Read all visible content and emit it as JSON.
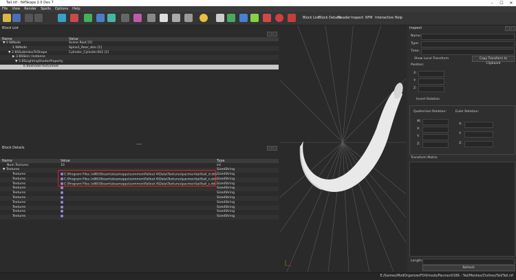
{
  "window": {
    "title": "Tail.nif - NifSkope 2.0 Dev 7"
  },
  "menu": [
    "File",
    "View",
    "Render",
    "Spells",
    "Options",
    "Help"
  ],
  "toolbar_buttons": [
    "Block List",
    "Block Details",
    "Header",
    "Inspect",
    "KFM",
    "Interactive Help"
  ],
  "block_list": {
    "title": "Block List",
    "columns": [
      "Name",
      "Value"
    ],
    "rows": [
      {
        "name": "▼ 0 NiNode",
        "value": "Scene Root [0]"
      },
      {
        "name": "1 NiNode",
        "value": "Spine1_Rear_skin [1]"
      },
      {
        "name": "▼ 2 BSSubIndexTriShape",
        "value": "Cylinder_Cylinder.002 [2]"
      },
      {
        "name": "▶ 3 BSSkin::Instance",
        "value": ""
      },
      {
        "name": "▼ 5 BSLightingShaderProperty",
        "value": ""
      },
      {
        "name": "6 BSShaderTextureSet",
        "value": ""
      }
    ]
  },
  "block_details": {
    "title": "Block Details",
    "columns": [
      "Name",
      "Value",
      "Type"
    ],
    "rows": [
      {
        "name": "Num Textures",
        "value": "10",
        "type": "int"
      },
      {
        "name": "▼ Textures",
        "value": "",
        "type": "SizedString"
      },
      {
        "name": "Textures",
        "value": "C:\\Program Files (x86)\\Steam\\steamapps\\common\\Fallout 4\\Data\\Textures\\pacmen\\tail\\tail_d.dds",
        "type": "SizedString"
      },
      {
        "name": "Textures",
        "value": "C:\\Program Files (x86)\\Steam\\steamapps\\common\\Fallout 4\\Data\\Textures\\pacmen\\tail\\tail_n.dds",
        "type": "SizedString"
      },
      {
        "name": "Textures",
        "value": "C:\\Program Files (x86)\\Steam\\steamapps\\common\\Fallout 4\\Data\\Textures\\pacmen\\tail\\tail_s.dds",
        "type": "SizedString"
      },
      {
        "name": "Textures",
        "value": "",
        "type": "SizedString"
      },
      {
        "name": "Textures",
        "value": "",
        "type": "SizedString"
      },
      {
        "name": "Textures",
        "value": "",
        "type": "SizedString"
      },
      {
        "name": "Textures",
        "value": "",
        "type": "SizedString"
      },
      {
        "name": "Textures",
        "value": "",
        "type": "SizedString"
      },
      {
        "name": "Textures",
        "value": "",
        "type": "SizedString"
      },
      {
        "name": "Textures",
        "value": "",
        "type": "SizedString"
      }
    ]
  },
  "inspect": {
    "title": "Inspect",
    "fields": [
      "Name:",
      "Type:",
      "Time:"
    ],
    "show_local": "Show Local Transform",
    "copy_btn": "Copy Transform to Clipboard",
    "position": "Position:",
    "pos_axes": [
      "X:",
      "Y:",
      "Z:"
    ],
    "invert_rotation": "Invert Rotation",
    "quaternion": "Quaternion Rotation:",
    "quat_axes": [
      "W:",
      "X:",
      "Y:",
      "Z:"
    ],
    "euler": "Euler Rotation:",
    "euler_axes": [
      "X:",
      "Y:",
      "Z:"
    ],
    "transform_matrix": "Transform Matrix",
    "length": "Length:",
    "refresh": "Refresh"
  },
  "status": {
    "path": "E:/Games/ModOrganizerFO4/mods/Pacmen0186 - Tail/Meshes/Clothes/Tail/Tail.nif"
  },
  "colors": {
    "highlight_box": "#e0202a",
    "viewport_bg": "#2a2a2a"
  }
}
